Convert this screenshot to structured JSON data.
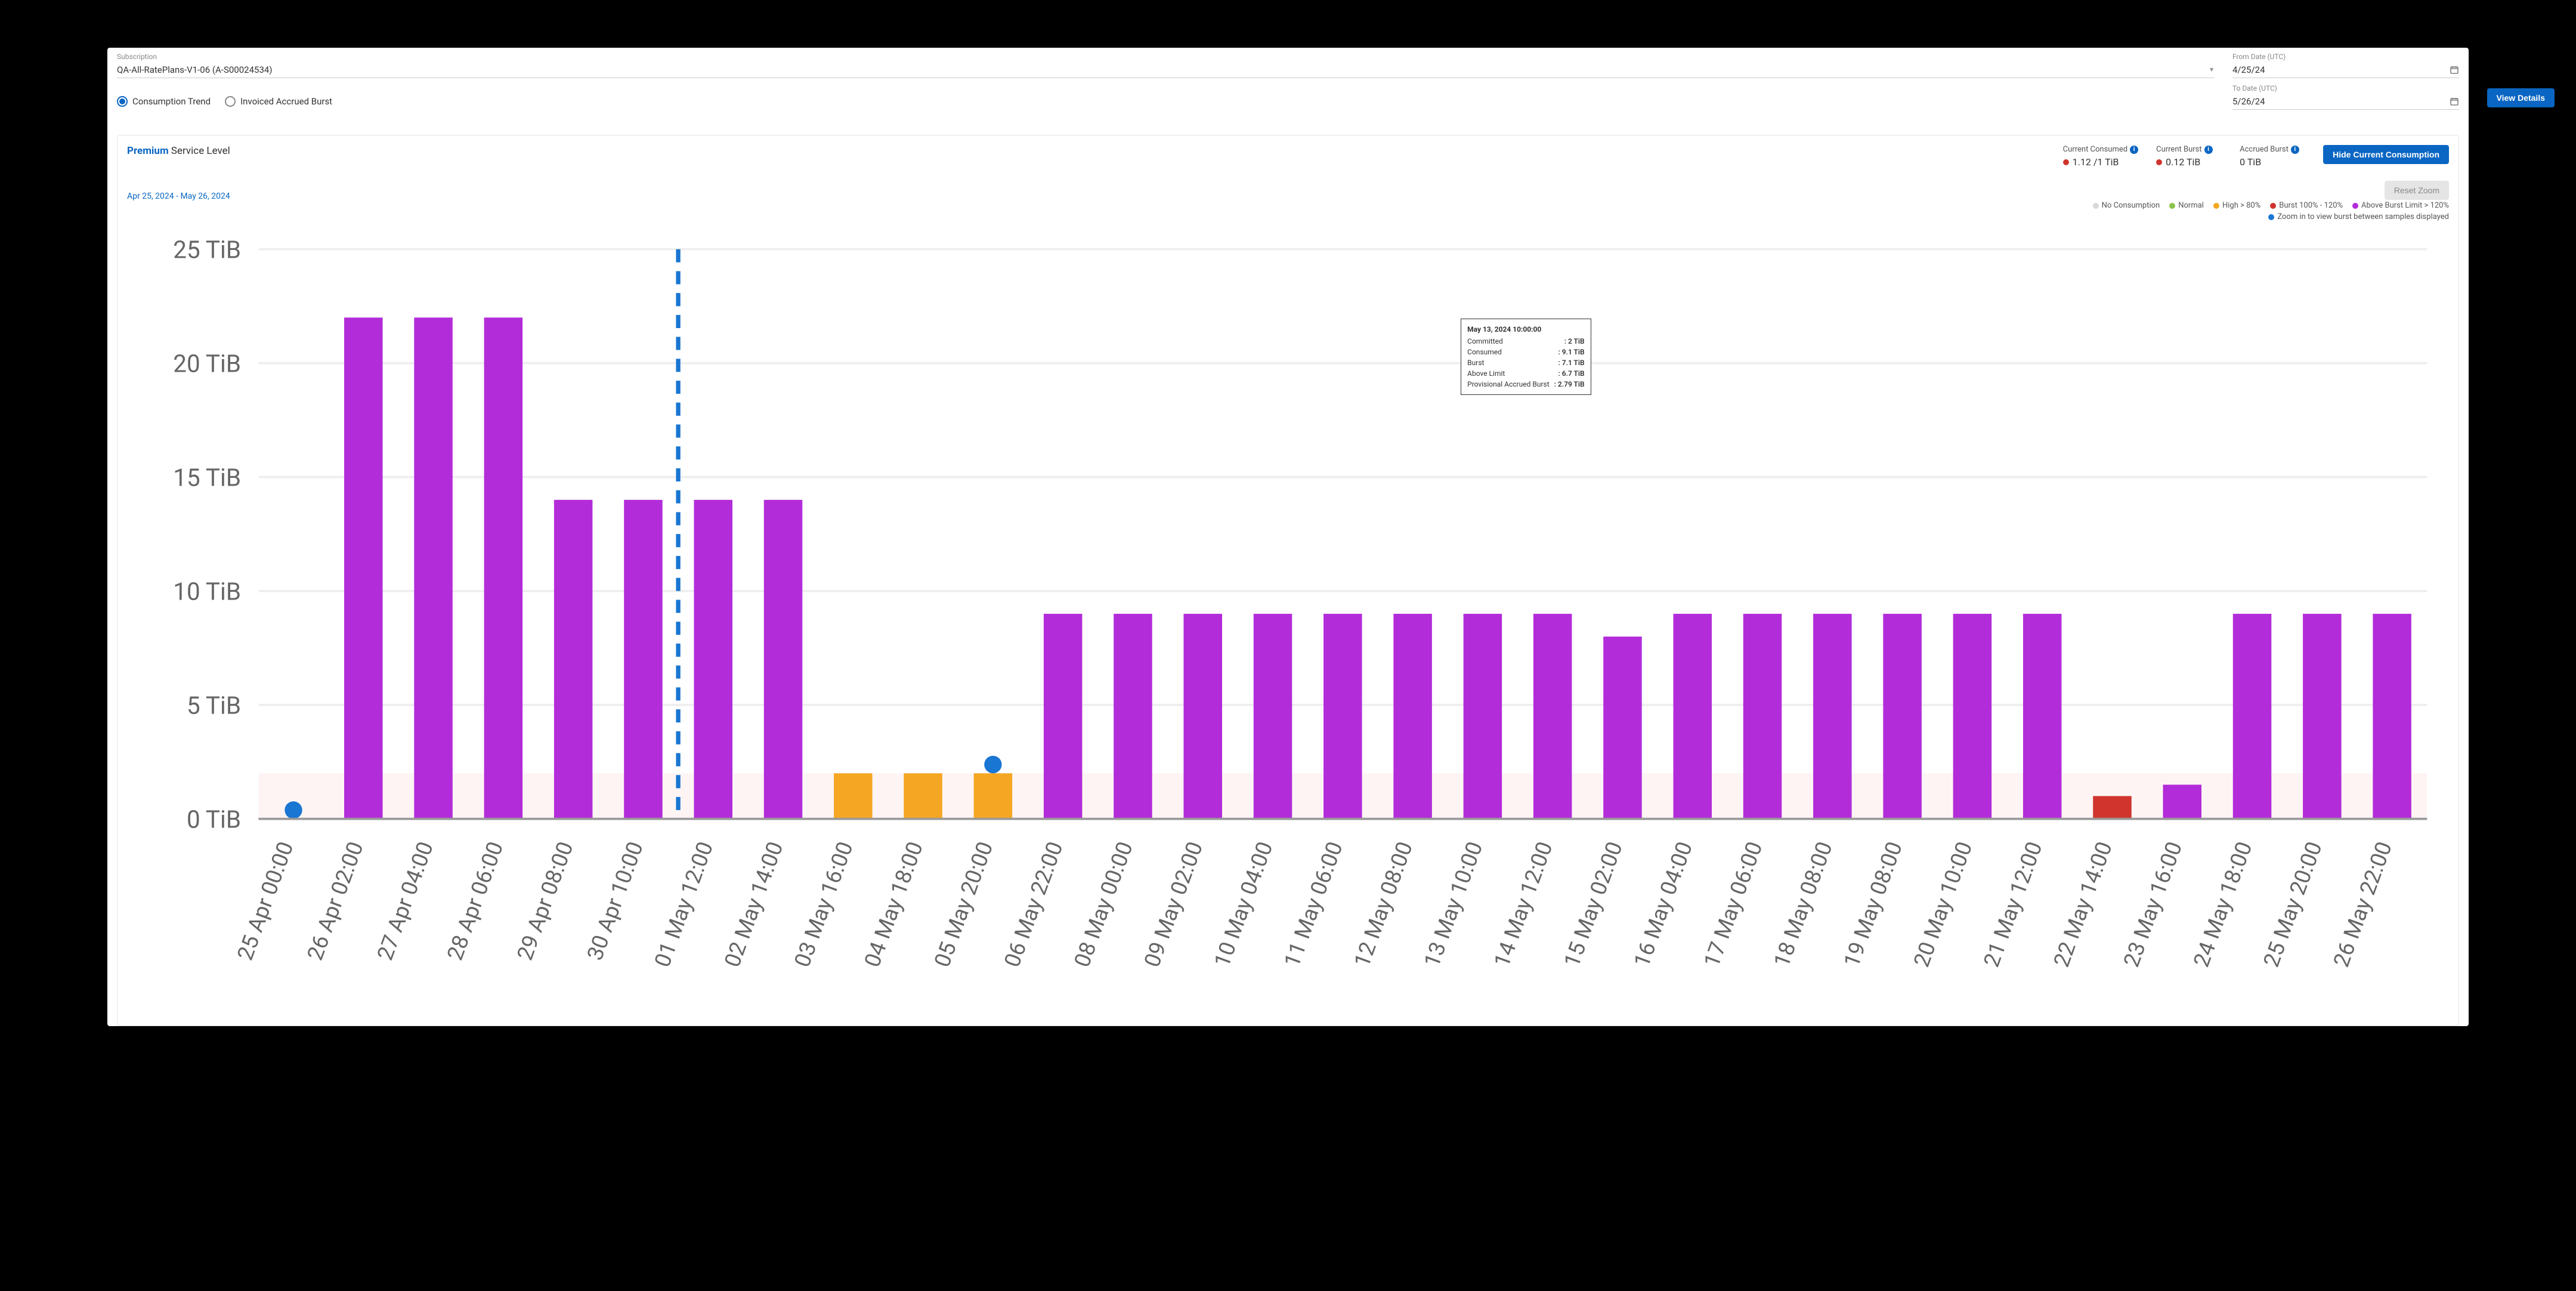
{
  "colors": {
    "blue": "#0a66c2",
    "purple": "#b22cd9",
    "orange": "#f5a623",
    "red": "#d0342c",
    "green": "#8bc34a",
    "grey": "#d8d8d8",
    "zoomBlue": "#1976d2"
  },
  "controls": {
    "subscription_label": "Subscription",
    "subscription_value": "QA-All-RatePlans-V1-06 (A-S00024534)",
    "from_label": "From Date (UTC)",
    "from_value": "4/25/24",
    "to_label": "To Date (UTC)",
    "to_value": "5/26/24",
    "view_details": "View Details",
    "radio_consumption": "Consumption Trend",
    "radio_invoiced": "Invoiced Accrued Burst"
  },
  "stats": {
    "service_tier": "Premium",
    "service_suffix": " Service Level",
    "current_consumed_label": "Current Consumed",
    "current_consumed_value": "1.12 /1 TiB",
    "current_burst_label": "Current Burst",
    "current_burst_value": "0.12 TiB",
    "accrued_burst_label": "Accrued Burst",
    "accrued_burst_value": "0 TiB",
    "hide_button": "Hide Current Consumption",
    "date_range": "Apr 25, 2024 - May 26, 2024",
    "reset_zoom": "Reset Zoom"
  },
  "legend": {
    "no_consumption": "No Consumption",
    "normal": "Normal",
    "high": "High > 80%",
    "burst": "Burst 100% - 120%",
    "above_burst": "Above Burst Limit > 120%",
    "zoom_hint": "Zoom in to view burst between samples displayed"
  },
  "tooltip": {
    "title": "May 13, 2024 10:00:00",
    "rows": [
      {
        "label": "Committed",
        "value": "2 TiB"
      },
      {
        "label": "Consumed",
        "value": "9.1 TiB"
      },
      {
        "label": "Burst",
        "value": "7.1 TiB"
      },
      {
        "label": "Above Limit",
        "value": "6.7 TiB"
      },
      {
        "label": "Provisional Accrued Burst",
        "value": "2.79 TiB"
      }
    ]
  },
  "chart_data": {
    "type": "bar",
    "title": "",
    "xlabel": "",
    "ylabel": "TiB",
    "ylim": [
      0,
      25
    ],
    "yTicks": [
      0,
      5,
      10,
      15,
      20,
      25
    ],
    "tickUnit": " TiB",
    "categories": [
      "25 Apr 00:00",
      "26 Apr 02:00",
      "27 Apr 04:00",
      "28 Apr 06:00",
      "29 Apr 08:00",
      "30 Apr 10:00",
      "01 May 12:00",
      "02 May 14:00",
      "03 May 16:00",
      "04 May 18:00",
      "05 May 20:00",
      "06 May 22:00",
      "08 May 00:00",
      "09 May 02:00",
      "10 May 04:00",
      "11 May 06:00",
      "12 May 08:00",
      "13 May 10:00",
      "14 May 12:00",
      "15 May 02:00",
      "16 May 04:00",
      "17 May 06:00",
      "18 May 08:00",
      "19 May 08:00",
      "20 May 10:00",
      "21 May 12:00",
      "22 May 14:00",
      "23 May 16:00",
      "24 May 18:00",
      "25 May 20:00",
      "26 May 22:00"
    ],
    "series": [
      {
        "name": "status",
        "values": [
          "none",
          "purple",
          "purple",
          "purple",
          "purple",
          "purple",
          "purple",
          "purple",
          "orange",
          "orange",
          "orange",
          "purple",
          "purple",
          "purple",
          "purple",
          "purple",
          "purple",
          "purple",
          "purple",
          "purple",
          "purple",
          "purple",
          "purple",
          "purple",
          "purple",
          "purple",
          "red",
          "purple",
          "purple",
          "purple",
          "purple"
        ]
      },
      {
        "name": "height_tib",
        "values": [
          0,
          22,
          22,
          22,
          14,
          14,
          14,
          14,
          2,
          2,
          2,
          9,
          9,
          9,
          9,
          9,
          9,
          9,
          9,
          8,
          9,
          9,
          9,
          9,
          9,
          9,
          1,
          1.5,
          9,
          9,
          9
        ]
      }
    ],
    "zoomDots": [
      0,
      10
    ],
    "dashedLineIndex": 5
  }
}
